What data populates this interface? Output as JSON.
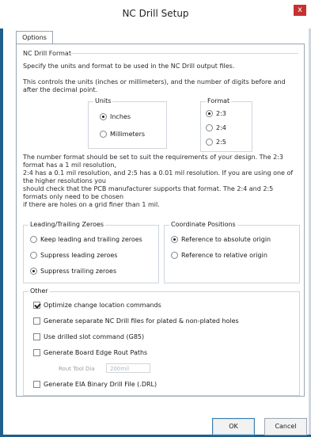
{
  "window": {
    "title": "NC Drill Setup",
    "close_glyph": "x"
  },
  "tabs": {
    "options_label": "Options"
  },
  "nc_drill_format": {
    "title": "NC Drill Format",
    "desc1": "Specify the units and format to be used in the NC Drill output files.",
    "desc2": "This controls the units (inches or millimeters), and the number of digits before and after the decimal point.",
    "units": {
      "label": "Units",
      "inches": "Inches",
      "millimeters": "Millimeters",
      "selected": "Inches"
    },
    "format": {
      "label": "Format",
      "opt_23": "2:3",
      "opt_24": "2:4",
      "opt_25": "2:5",
      "selected": "2:3"
    },
    "note": "The number format should be set to suit the requirements of your design. The 2:3 format has a 1 mil resolution,\n2:4 has a 0.1 mil resolution, and 2:5 has a 0.01 mil resolution. If you are using one of the higher resolutions you\nshould check that the PCB manufacturer supports that format. The 2:4 and 2:5 formats only need to be chosen\nif there are holes on a grid finer than 1 mil."
  },
  "leading_trailing": {
    "label": "Leading/Trailing Zeroes",
    "keep": "Keep leading and trailing zeroes",
    "suppress_leading": "Suppress leading zeroes",
    "suppress_trailing": "Suppress trailing zeroes",
    "selected": "Suppress trailing zeroes"
  },
  "coordinate_positions": {
    "label": "Coordinate Positions",
    "absolute": "Reference to absolute origin",
    "relative": "Reference to relative origin",
    "selected": "Reference to absolute origin"
  },
  "other": {
    "label": "Other",
    "optimize": "Optimize change location commands",
    "separate": "Generate separate NC Drill files for plated & non-plated holes",
    "use_slot": "Use drilled slot command (G85)",
    "edge_paths": "Generate Board Edge Rout Paths",
    "rout_tool_label": "Rout Tool Dia",
    "rout_tool_value": "200mil",
    "eia_binary": "Generate EIA Binary Drill File (.DRL)",
    "checked": {
      "optimize": true,
      "separate": false,
      "use_slot": false,
      "edge_paths": false,
      "eia_binary": false
    }
  },
  "buttons": {
    "ok": "OK",
    "cancel": "Cancel"
  },
  "colors": {
    "title_close_bg": "#c7302f",
    "border_blue": "#1f5f8b"
  }
}
